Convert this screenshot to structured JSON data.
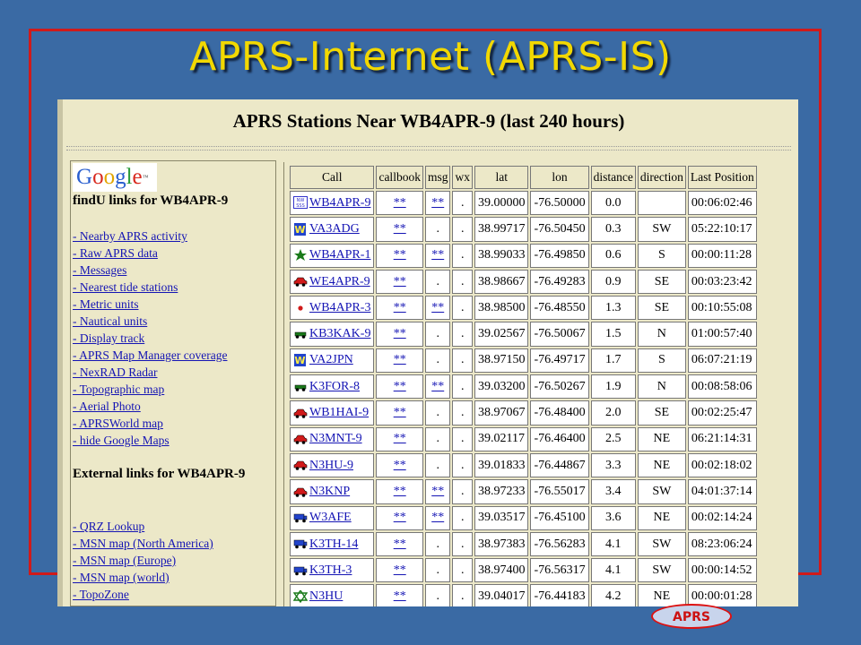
{
  "slide": {
    "title": "APRS-Internet (APRS-IS)"
  },
  "page": {
    "title": "APRS Stations Near WB4APR-9 (last 240 hours)"
  },
  "left_panel": {
    "logo_text": "Google",
    "findu_heading": "findU links for WB4APR-9",
    "findu_links": [
      "- Nearby APRS activity",
      "- Raw APRS data",
      "- Messages",
      "- Nearest tide stations",
      "- Metric units",
      "- Nautical units",
      "- Display track",
      "- APRS Map Manager coverage",
      "- NexRAD Radar",
      "- Topographic map",
      "- Aerial Photo",
      "- APRSWorld map",
      "- hide Google Maps"
    ],
    "external_heading": "External links for WB4APR-9",
    "external_links": [
      "- QRZ Lookup",
      "- MSN map (North America)",
      "- MSN map (Europe)",
      "- MSN map (world)",
      "- TopoZone"
    ]
  },
  "table": {
    "headers": [
      "Call",
      "callbook",
      "msg",
      "wx",
      "lat",
      "lon",
      "distance",
      "direction",
      "Last Position"
    ],
    "rows": [
      {
        "icon": "weather-station-icon",
        "call": "WB4APR-9",
        "callbook": "**",
        "msg": "**",
        "wx": ".",
        "lat": "39.00000",
        "lon": "-76.50000",
        "distance": "0.0",
        "direction": "",
        "last": "00:06:02:46"
      },
      {
        "icon": "wx-w-icon",
        "call": "VA3ADG",
        "callbook": "**",
        "msg": ".",
        "wx": ".",
        "lat": "38.99717",
        "lon": "-76.50450",
        "distance": "0.3",
        "direction": "SW",
        "last": "05:22:10:17"
      },
      {
        "icon": "star-icon",
        "call": "WB4APR-1",
        "callbook": "**",
        "msg": "**",
        "wx": ".",
        "lat": "38.99033",
        "lon": "-76.49850",
        "distance": "0.6",
        "direction": "S",
        "last": "00:00:11:28"
      },
      {
        "icon": "car-icon",
        "call": "WE4APR-9",
        "callbook": "**",
        "msg": ".",
        "wx": ".",
        "lat": "38.98667",
        "lon": "-76.49283",
        "distance": "0.9",
        "direction": "SE",
        "last": "00:03:23:42"
      },
      {
        "icon": "red-dot-icon",
        "call": "WB4APR-3",
        "callbook": "**",
        "msg": "**",
        "wx": ".",
        "lat": "38.98500",
        "lon": "-76.48550",
        "distance": "1.3",
        "direction": "SE",
        "last": "00:10:55:08"
      },
      {
        "icon": "jeep-icon",
        "call": "KB3KAK-9",
        "callbook": "**",
        "msg": ".",
        "wx": ".",
        "lat": "39.02567",
        "lon": "-76.50067",
        "distance": "1.5",
        "direction": "N",
        "last": "01:00:57:40"
      },
      {
        "icon": "wx-w-icon",
        "call": "VA2JPN",
        "callbook": "**",
        "msg": ".",
        "wx": ".",
        "lat": "38.97150",
        "lon": "-76.49717",
        "distance": "1.7",
        "direction": "S",
        "last": "06:07:21:19"
      },
      {
        "icon": "jeep-icon",
        "call": "K3FOR-8",
        "callbook": "**",
        "msg": "**",
        "wx": ".",
        "lat": "39.03200",
        "lon": "-76.50267",
        "distance": "1.9",
        "direction": "N",
        "last": "00:08:58:06"
      },
      {
        "icon": "car-icon",
        "call": "WB1HAI-9",
        "callbook": "**",
        "msg": ".",
        "wx": ".",
        "lat": "38.97067",
        "lon": "-76.48400",
        "distance": "2.0",
        "direction": "SE",
        "last": "00:02:25:47"
      },
      {
        "icon": "car-icon",
        "call": "N3MNT-9",
        "callbook": "**",
        "msg": ".",
        "wx": ".",
        "lat": "39.02117",
        "lon": "-76.46400",
        "distance": "2.5",
        "direction": "NE",
        "last": "06:21:14:31"
      },
      {
        "icon": "car-icon",
        "call": "N3HU-9",
        "callbook": "**",
        "msg": ".",
        "wx": ".",
        "lat": "39.01833",
        "lon": "-76.44867",
        "distance": "3.3",
        "direction": "NE",
        "last": "00:02:18:02"
      },
      {
        "icon": "car-icon",
        "call": "N3KNP",
        "callbook": "**",
        "msg": "**",
        "wx": ".",
        "lat": "38.97233",
        "lon": "-76.55017",
        "distance": "3.4",
        "direction": "SW",
        "last": "04:01:37:14"
      },
      {
        "icon": "van-icon",
        "call": "W3AFE",
        "callbook": "**",
        "msg": "**",
        "wx": ".",
        "lat": "39.03517",
        "lon": "-76.45100",
        "distance": "3.6",
        "direction": "NE",
        "last": "00:02:14:24"
      },
      {
        "icon": "van-icon",
        "call": "K3TH-14",
        "callbook": "**",
        "msg": ".",
        "wx": ".",
        "lat": "38.97383",
        "lon": "-76.56283",
        "distance": "4.1",
        "direction": "SW",
        "last": "08:23:06:24"
      },
      {
        "icon": "van-icon",
        "call": "K3TH-3",
        "callbook": "**",
        "msg": ".",
        "wx": ".",
        "lat": "38.97400",
        "lon": "-76.56317",
        "distance": "4.1",
        "direction": "SW",
        "last": "00:00:14:52"
      },
      {
        "icon": "home-icon",
        "call": "N3HU",
        "callbook": "**",
        "msg": ".",
        "wx": ".",
        "lat": "39.04017",
        "lon": "-76.44183",
        "distance": "4.2",
        "direction": "NE",
        "last": "00:00:01:28"
      }
    ]
  },
  "colors": {
    "background": "#3a6aa4",
    "title": "#f2d800",
    "frame": "#d01a1a",
    "link": "#1414b4",
    "page": "#ece8c8"
  }
}
